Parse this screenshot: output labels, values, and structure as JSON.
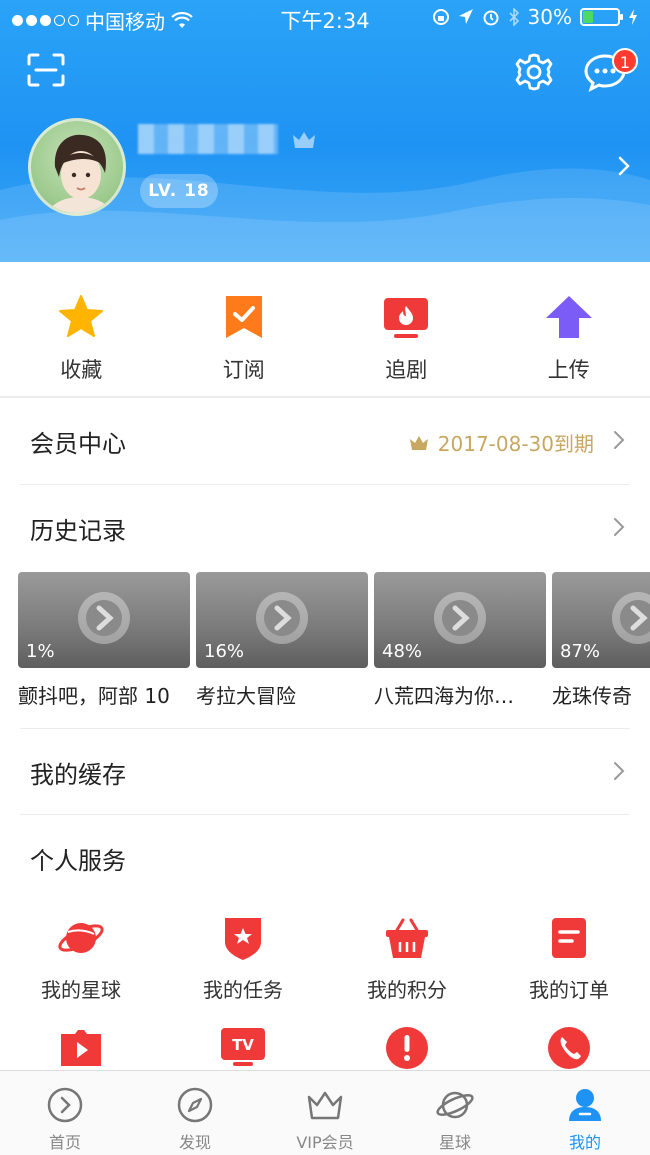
{
  "status_bar": {
    "carrier": "中国移动",
    "time": "下午2:34",
    "battery": "30%",
    "battery_level": 0.3
  },
  "header": {
    "level": "LV. 18",
    "message_badge": "1"
  },
  "quick_actions": [
    {
      "label": "收藏",
      "icon": "star-icon"
    },
    {
      "label": "订阅",
      "icon": "bookmark-check-icon"
    },
    {
      "label": "追剧",
      "icon": "tv-flame-icon"
    },
    {
      "label": "上传",
      "icon": "upload-arrow-icon"
    }
  ],
  "vip_center": {
    "title": "会员中心",
    "expire_text": "2017-08-30到期"
  },
  "history": {
    "title": "历史记录",
    "items": [
      {
        "progress": "1%",
        "title": "颤抖吧，阿部 10"
      },
      {
        "progress": "16%",
        "title": "考拉大冒险"
      },
      {
        "progress": "48%",
        "title": "八荒四海为你…"
      },
      {
        "progress": "87%",
        "title": "龙珠传奇"
      }
    ]
  },
  "cache": {
    "title": "我的缓存"
  },
  "services": {
    "title": "个人服务",
    "items": [
      {
        "label": "我的星球",
        "icon": "planet-icon"
      },
      {
        "label": "我的任务",
        "icon": "task-shield-icon"
      },
      {
        "label": "我的积分",
        "icon": "basket-icon"
      },
      {
        "label": "我的订单",
        "icon": "order-doc-icon"
      },
      {
        "label": "",
        "icon": "video-play-icon"
      },
      {
        "label": "",
        "icon": "tv-icon"
      },
      {
        "label": "",
        "icon": "alert-icon"
      },
      {
        "label": "",
        "icon": "phone-icon"
      }
    ]
  },
  "tabbar": [
    {
      "label": "首页",
      "icon": "home-play-icon",
      "active": false
    },
    {
      "label": "发现",
      "icon": "compass-icon",
      "active": false
    },
    {
      "label": "VIP会员",
      "icon": "crown-icon",
      "active": false
    },
    {
      "label": "星球",
      "icon": "planet-outline-icon",
      "active": false
    },
    {
      "label": "我的",
      "icon": "user-icon",
      "active": true
    }
  ],
  "colors": {
    "header_blue": "#1f93f3",
    "accent_red": "#f03a3a",
    "vip_gold": "#c8a760",
    "active_tab": "#1f93f3"
  }
}
